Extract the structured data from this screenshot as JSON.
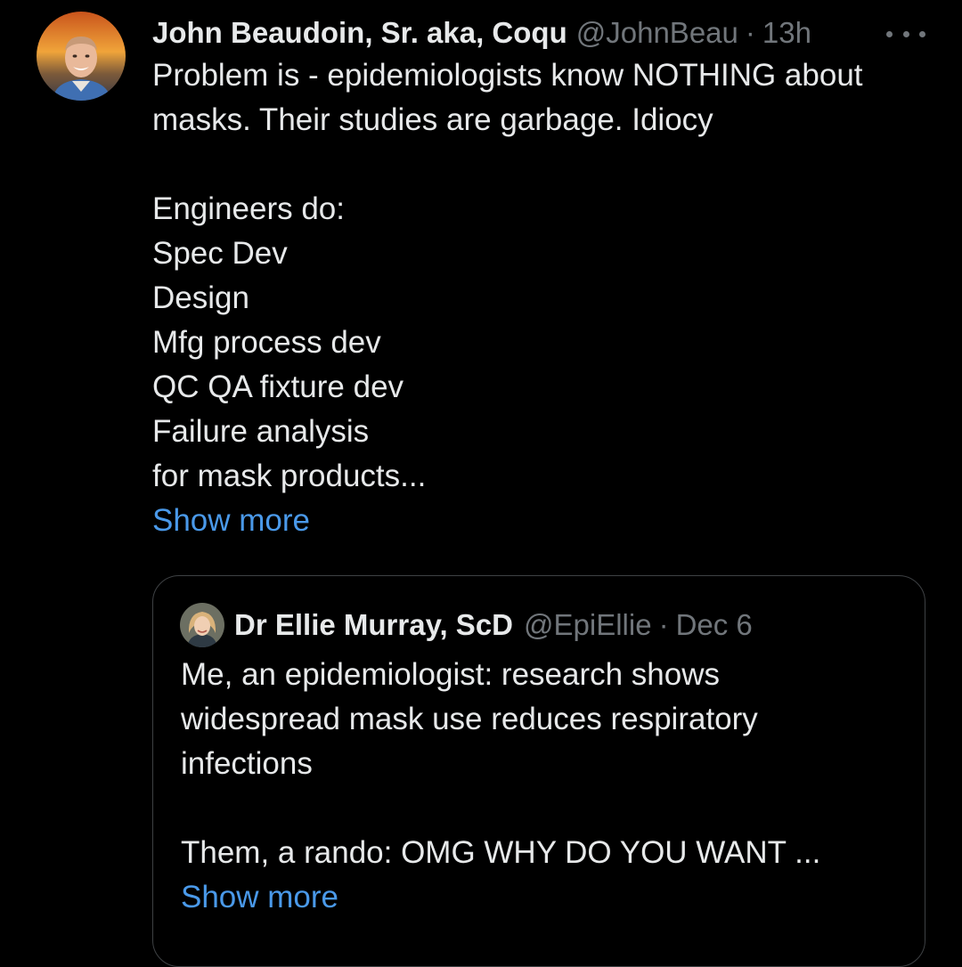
{
  "tweet": {
    "display_name": "John Beaudoin, Sr. aka, Coqu",
    "handle": "@JohnBeau",
    "separator": "·",
    "time": "13h",
    "text_lines": [
      "Problem is - epidemiologists know NOTHING about",
      "masks. Their studies are garbage. Idiocy",
      "",
      "Engineers do:",
      "Spec Dev",
      "Design",
      "Mfg process dev",
      "QC QA fixture dev",
      "Failure analysis",
      "for mask products..."
    ],
    "show_more_label": "Show more",
    "more_icon": "more-horizontal-icon"
  },
  "quote": {
    "display_name": "Dr Ellie Murray, ScD",
    "handle": "@EpiEllie",
    "separator": "·",
    "time": "Dec 6",
    "text_lines": [
      "Me, an epidemiologist: research shows",
      "widespread mask use reduces respiratory",
      "infections",
      "",
      "Them, a rando: OMG WHY DO YOU WANT ..."
    ],
    "show_more_label": "Show more"
  },
  "colors": {
    "background": "#000000",
    "primary_text": "#e7e9ea",
    "secondary_text": "#71767b",
    "link": "#4a99e9",
    "border": "#3e4144"
  }
}
